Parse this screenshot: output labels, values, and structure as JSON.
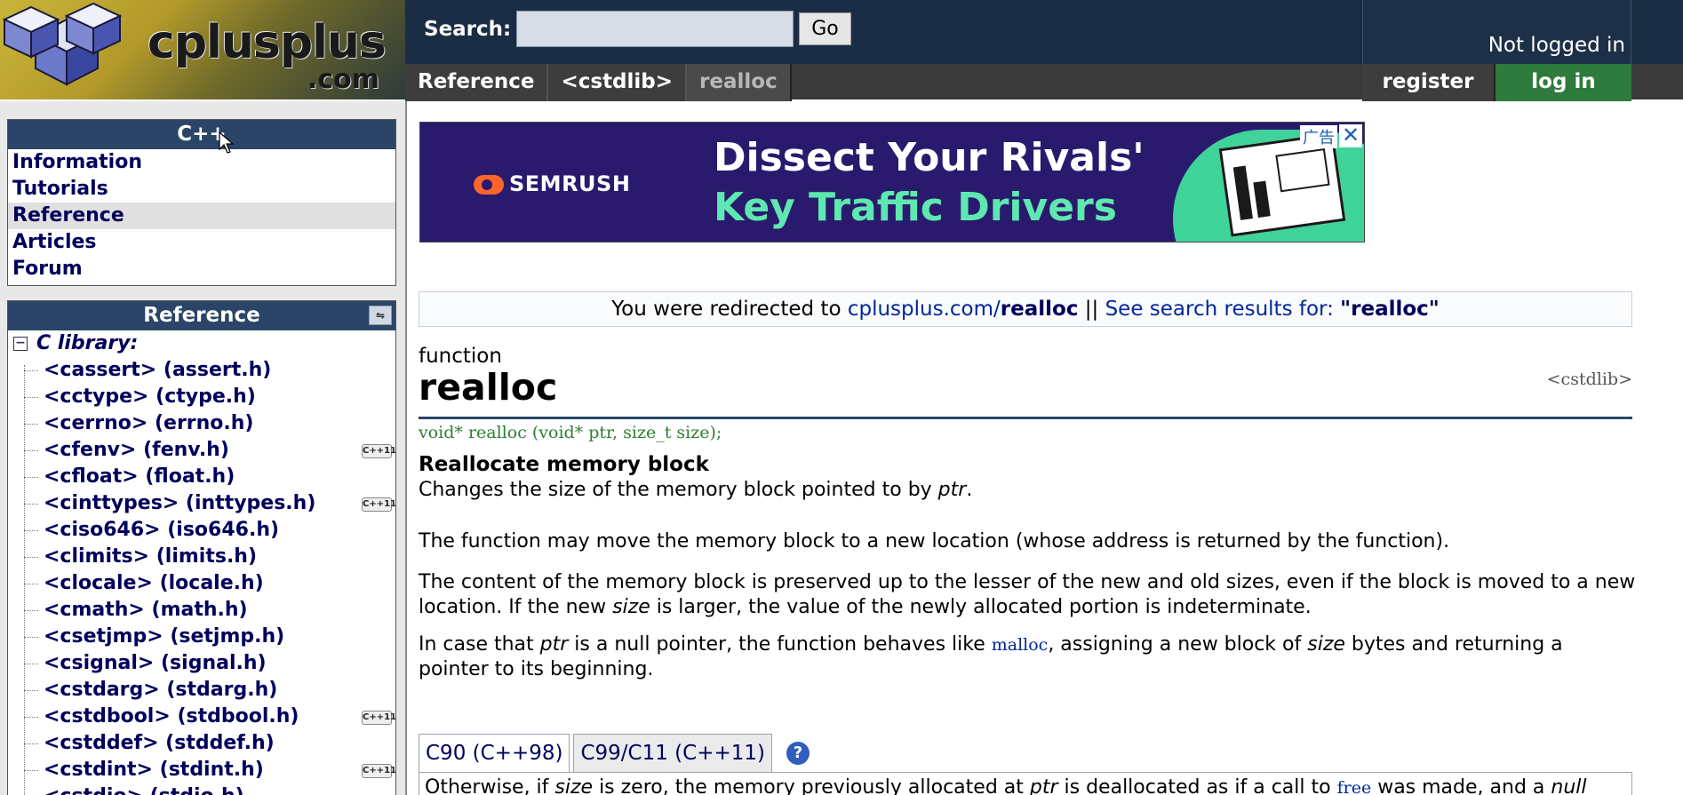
{
  "header": {
    "logo_text": "cplusplus",
    "logo_com": ".com",
    "search_label": "Search:",
    "search_value": "",
    "go_label": "Go",
    "breadcrumb": [
      "Reference",
      "<cstdlib>",
      "realloc"
    ],
    "not_logged_in": "Not logged in",
    "register_label": "register",
    "login_label": "log in"
  },
  "sidebar": {
    "cpp_box_title": "C++",
    "nav_items": [
      {
        "label": "Information",
        "active": false
      },
      {
        "label": "Tutorials",
        "active": false
      },
      {
        "label": "Reference",
        "active": true
      },
      {
        "label": "Articles",
        "active": false
      },
      {
        "label": "Forum",
        "active": false
      }
    ],
    "reference_title": "Reference",
    "reference_icon": "book-icon",
    "c_library_label": "C library:",
    "c_library_toggle": "−",
    "libraries": [
      {
        "label": "<cassert> (assert.h)",
        "cpp11": false
      },
      {
        "label": "<cctype> (ctype.h)",
        "cpp11": false
      },
      {
        "label": "<cerrno> (errno.h)",
        "cpp11": false
      },
      {
        "label": "<cfenv> (fenv.h)",
        "cpp11": true
      },
      {
        "label": "<cfloat> (float.h)",
        "cpp11": false
      },
      {
        "label": "<cinttypes> (inttypes.h)",
        "cpp11": true
      },
      {
        "label": "<ciso646> (iso646.h)",
        "cpp11": false
      },
      {
        "label": "<climits> (limits.h)",
        "cpp11": false
      },
      {
        "label": "<clocale> (locale.h)",
        "cpp11": false
      },
      {
        "label": "<cmath> (math.h)",
        "cpp11": false
      },
      {
        "label": "<csetjmp> (setjmp.h)",
        "cpp11": false
      },
      {
        "label": "<csignal> (signal.h)",
        "cpp11": false
      },
      {
        "label": "<cstdarg> (stdarg.h)",
        "cpp11": false
      },
      {
        "label": "<cstdbool> (stdbool.h)",
        "cpp11": true
      },
      {
        "label": "<cstddef> (stddef.h)",
        "cpp11": false
      },
      {
        "label": "<cstdint> (stdint.h)",
        "cpp11": true
      },
      {
        "label": "<cstdio> (stdio.h)",
        "cpp11": false
      }
    ],
    "cpp11_badge": "C++11"
  },
  "ad": {
    "brand": "SEMRUSH",
    "line1": "Dissect Your Rivals'",
    "line2": "Key Traffic Drivers",
    "label": "广告",
    "close": "✕",
    "colors": {
      "background": "#2a1a6e",
      "accent": "#5ee8b0",
      "logo": "#ff642d"
    }
  },
  "redirect": {
    "prefix": "You were redirected to ",
    "site": "cplusplus.com/",
    "page": "realloc",
    "separator": " || ",
    "search_text": "See search results for: ",
    "search_term": "\"realloc\""
  },
  "function": {
    "kind": "function",
    "name": "realloc",
    "header": "<cstdlib>",
    "prototype": "void* realloc (void* ptr, size_t size);",
    "short_description": "Reallocate memory block"
  },
  "paragraphs": {
    "p1_a": "Changes the size of the memory block pointed to by ",
    "p1_b": "ptr",
    "p1_c": ".",
    "p2": "The function may move the memory block to a new location (whose address is returned by the function).",
    "p3_a": "The content of the memory block is preserved up to the lesser of the new and old sizes, even if the block is moved to a new location. If the new ",
    "p3_b": "size",
    "p3_c": " is larger, the value of the newly allocated portion is indeterminate.",
    "p4_a": "In case that ",
    "p4_b": "ptr",
    "p4_c": " is a null pointer, the function behaves like ",
    "p4_d": "malloc",
    "p4_e": ", assigning a new block of ",
    "p4_f": "size",
    "p4_g": " bytes and returning a pointer to its beginning."
  },
  "tabs": {
    "items": [
      "C90 (C++98)",
      "C99/C11 (C++11)"
    ],
    "help": "?",
    "panel_a": "Otherwise, if ",
    "panel_b": "size",
    "panel_c": " is zero, the memory previously allocated at ",
    "panel_d": "ptr",
    "panel_e": " is deallocated as if a call to ",
    "panel_f": "free",
    "panel_g": " was made, and a ",
    "panel_h": "null"
  }
}
